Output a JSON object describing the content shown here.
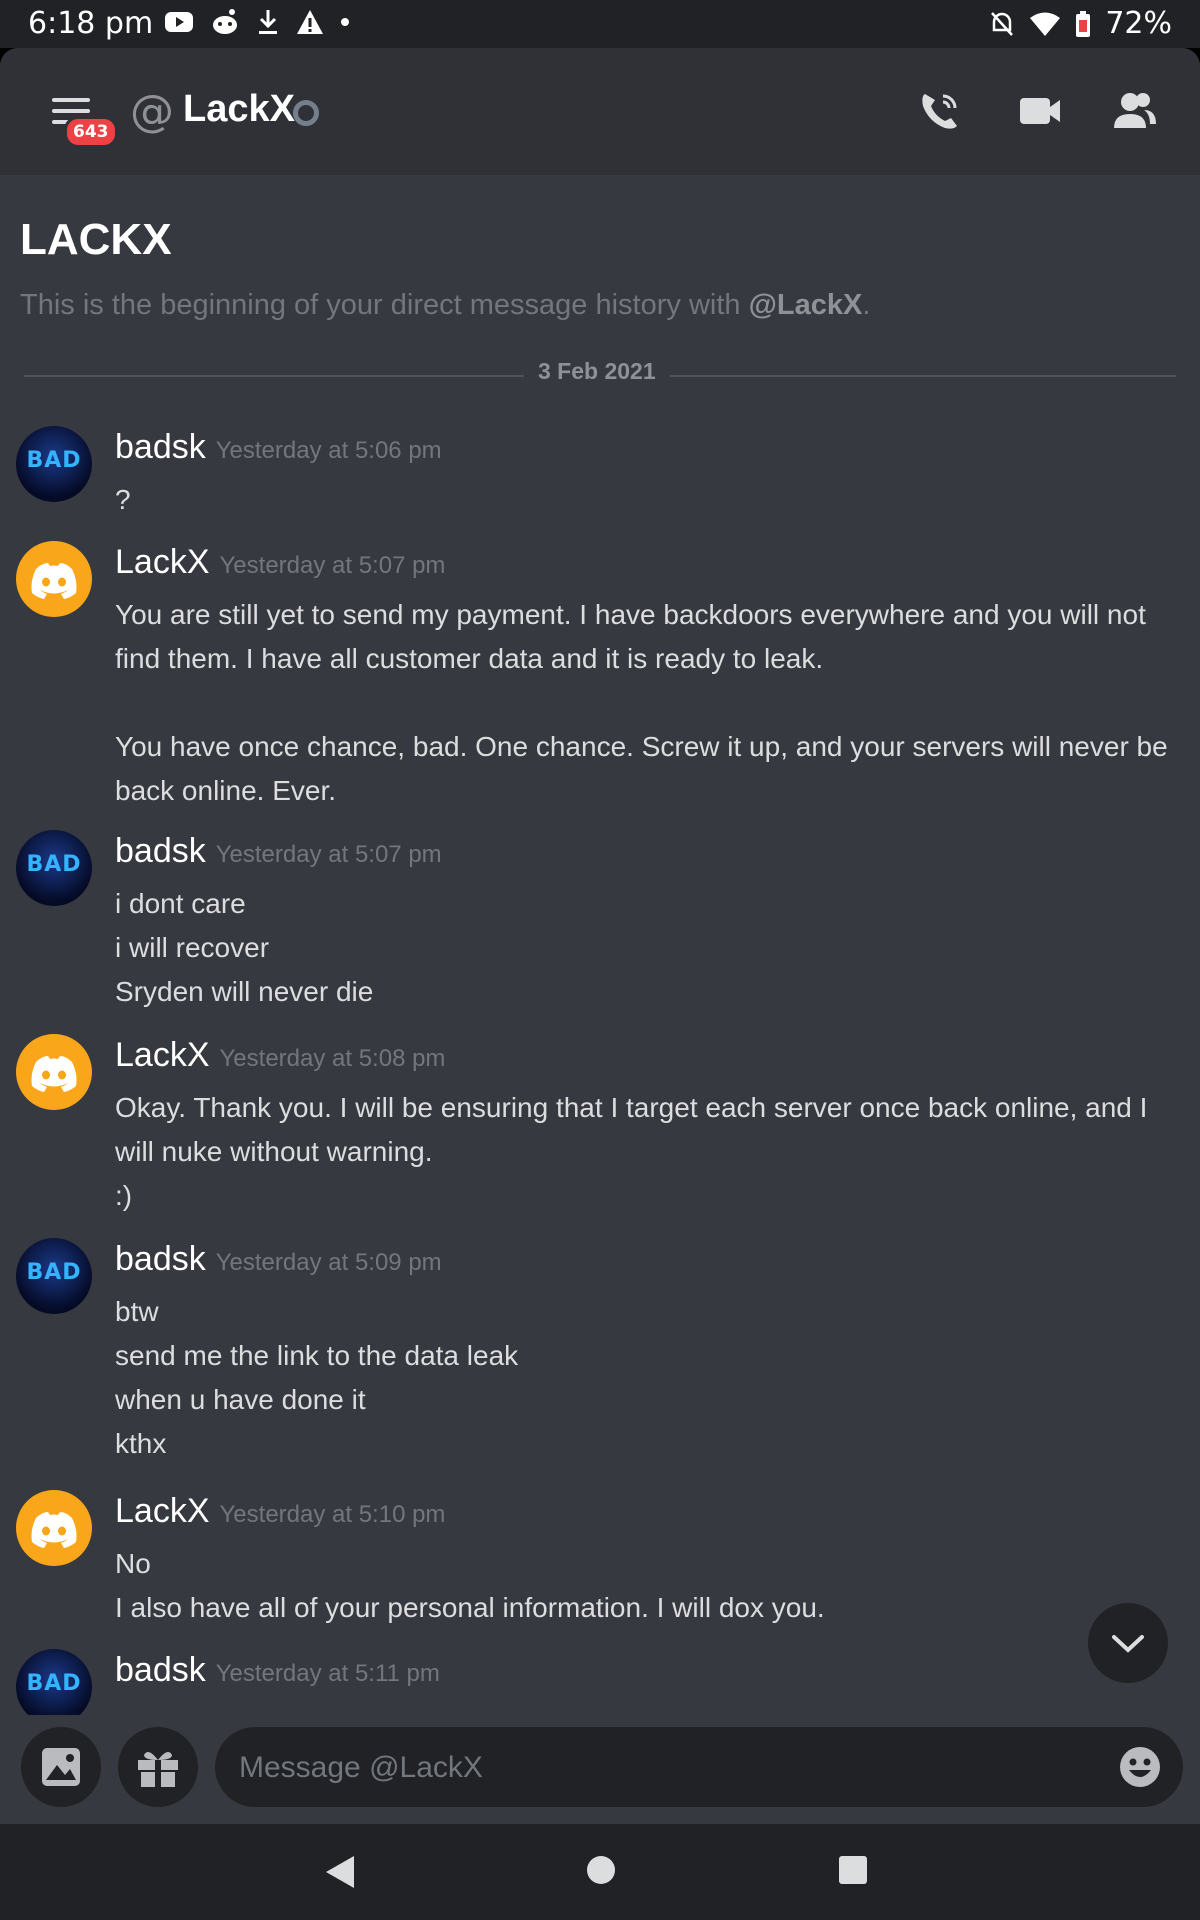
{
  "status_bar": {
    "time": "6:18 pm",
    "battery": "72%"
  },
  "header": {
    "unread_count": "643",
    "channel_name": "LackX"
  },
  "intro": {
    "title": "LACKX",
    "subtitle_prefix": "This is the beginning of your direct message history with ",
    "subtitle_user": "@LackX",
    "subtitle_suffix": "."
  },
  "date_divider": "3 Feb 2021",
  "messages": [
    {
      "author": "badsk",
      "time": "Yesterday at 5:06 pm",
      "lines": [
        "?"
      ]
    },
    {
      "author": "LackX",
      "time": "Yesterday at 5:07 pm",
      "lines": [
        "You are still yet to send my payment. I have backdoors everywhere and you will not find them. I have all customer data and it is ready to leak.",
        "You have once chance, bad. One chance. Screw it up, and your servers will never be back online. Ever."
      ]
    },
    {
      "author": "badsk",
      "time": "Yesterday at 5:07 pm",
      "lines": [
        "i dont care",
        "i will recover",
        "Sryden will never die"
      ]
    },
    {
      "author": "LackX",
      "time": "Yesterday at 5:08 pm",
      "lines": [
        "Okay. Thank you. I will be ensuring that I target each server once back online, and I will nuke without warning.",
        ":)"
      ]
    },
    {
      "author": "badsk",
      "time": "Yesterday at 5:09 pm",
      "lines": [
        "btw",
        "send me the link to the data leak",
        "when u have done it",
        "kthx"
      ]
    },
    {
      "author": "LackX",
      "time": "Yesterday at 5:10 pm",
      "lines": [
        "No",
        "I also have all of your personal information. I will dox you."
      ]
    },
    {
      "author": "badsk",
      "time": "Yesterday at 5:11 pm",
      "lines": []
    }
  ],
  "composer": {
    "placeholder": "Message @LackX"
  },
  "avatars": {
    "badsk": "BAD"
  },
  "colors": {
    "background": "#36393f",
    "header": "#2f3136",
    "input": "#202225",
    "accent_orange": "#faa61a",
    "badge_red": "#ed4245"
  }
}
